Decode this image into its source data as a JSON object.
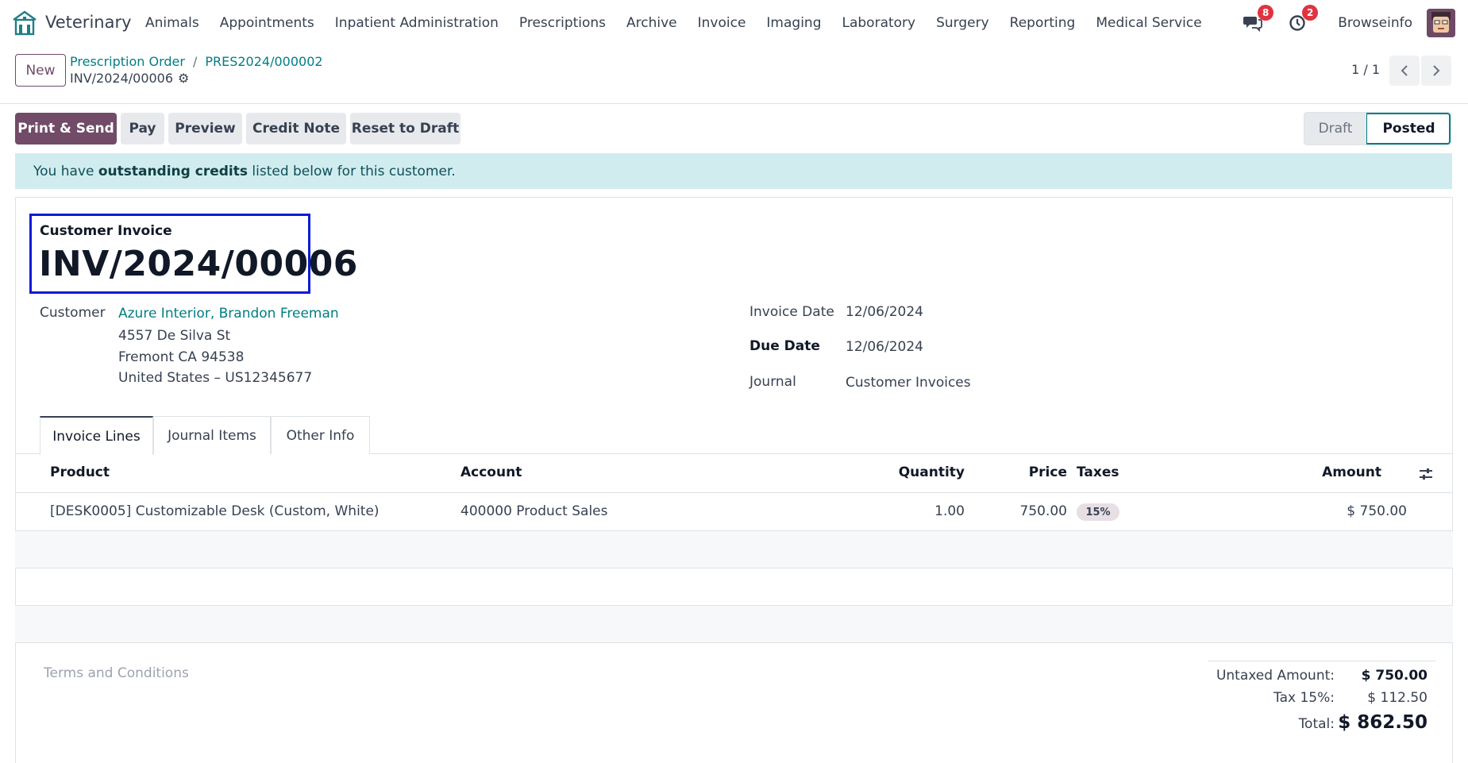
{
  "app": {
    "name": "Veterinary"
  },
  "menu": [
    "Animals",
    "Appointments",
    "Inpatient Administration",
    "Prescriptions",
    "Archive",
    "Invoice",
    "Imaging",
    "Laboratory",
    "Surgery",
    "Reporting",
    "Medical Service"
  ],
  "systray": {
    "messages_count": "8",
    "activities_count": "2",
    "company": "Browseinfo"
  },
  "control": {
    "new_label": "New",
    "breadcrumb": [
      "Prescription Order",
      "PRES2024/000002"
    ],
    "current": "INV/2024/00006",
    "pager": "1 / 1"
  },
  "actions": [
    "Print & Send",
    "Pay",
    "Preview",
    "Credit Note",
    "Reset to Draft"
  ],
  "status": {
    "steps": [
      "Draft",
      "Posted"
    ],
    "active": "Posted"
  },
  "alert": {
    "prefix": "You have ",
    "bold": "outstanding credits",
    "suffix": " listed below for this customer."
  },
  "invoice": {
    "type_label": "Customer Invoice",
    "number": "INV/2024/00006",
    "customer_label": "Customer",
    "customer_name": "Azure Interior, Brandon Freeman",
    "address": [
      "4557 De Silva St",
      "Fremont CA 94538",
      "United States – US12345677"
    ],
    "invoice_date_label": "Invoice Date",
    "invoice_date": "12/06/2024",
    "due_date_label": "Due Date",
    "due_date": "12/06/2024",
    "journal_label": "Journal",
    "journal": "Customer Invoices"
  },
  "tabs": [
    "Invoice Lines",
    "Journal Items",
    "Other Info"
  ],
  "lines": {
    "headers": {
      "product": "Product",
      "account": "Account",
      "quantity": "Quantity",
      "price": "Price",
      "taxes": "Taxes",
      "amount": "Amount"
    },
    "rows": [
      {
        "product": "[DESK0005] Customizable Desk (Custom, White)",
        "account": "400000 Product Sales",
        "quantity": "1.00",
        "price": "750.00",
        "taxes": "15%",
        "amount": "$ 750.00"
      }
    ]
  },
  "footer": {
    "terms_placeholder": "Terms and Conditions",
    "untaxed_label": "Untaxed Amount:",
    "untaxed_value": "$ 750.00",
    "tax_label": "Tax 15%:",
    "tax_value": "$ 112.50",
    "total_label": "Total:",
    "total_value": "$ 862.50"
  },
  "colors": {
    "brand": "#714b67",
    "link": "#017e84",
    "highlight_box": "#0a1ad6",
    "alert_bg": "#d1ecef",
    "badge": "#e0333f"
  }
}
